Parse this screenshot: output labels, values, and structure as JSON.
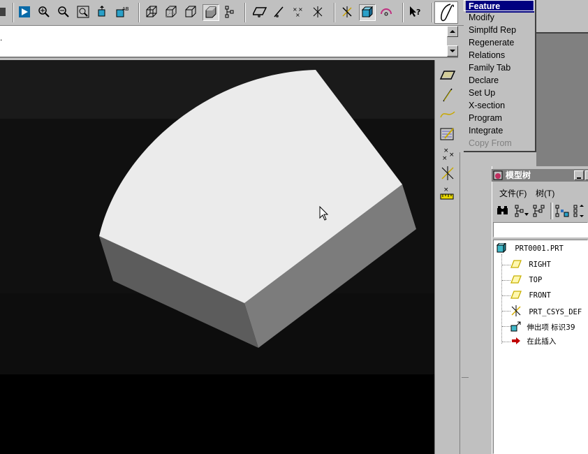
{
  "toolbar": {
    "buttons": [
      "regenerate-icon",
      "zoom-in-icon",
      "zoom-out-icon",
      "refit-icon",
      "orient-icon",
      "saved-views-icon",
      "wireframe-icon",
      "hidden-line-icon",
      "no-hidden-icon",
      "shading-icon",
      "model-tree-icon",
      "datum-planes-icon",
      "datum-axes-icon",
      "datum-points-icon",
      "coordinate-systems-icon",
      "spin-center-icon",
      "spin-box-icon",
      "spin-rotate-icon",
      "context-help-icon",
      "pro-engineer-logo"
    ]
  },
  "menu_manager": {
    "items": [
      {
        "label": "Feature",
        "selected": true,
        "disabled": false
      },
      {
        "label": "Modify",
        "selected": false,
        "disabled": false
      },
      {
        "label": "Simplfd Rep",
        "selected": false,
        "disabled": false
      },
      {
        "label": "Regenerate",
        "selected": false,
        "disabled": false
      },
      {
        "label": "Relations",
        "selected": false,
        "disabled": false
      },
      {
        "label": "Family Tab",
        "selected": false,
        "disabled": false
      },
      {
        "label": "Declare",
        "selected": false,
        "disabled": false
      },
      {
        "label": "Set Up",
        "selected": false,
        "disabled": false
      },
      {
        "label": "X-section",
        "selected": false,
        "disabled": false
      },
      {
        "label": "Program",
        "selected": false,
        "disabled": false
      },
      {
        "label": "Integrate",
        "selected": false,
        "disabled": false
      },
      {
        "label": "Copy From",
        "selected": false,
        "disabled": true
      }
    ]
  },
  "message_area": {
    "text": "."
  },
  "model_tree": {
    "title": "模型树",
    "menus": [
      "文件(F)",
      "树(T)"
    ],
    "nodes": [
      {
        "label": "PRT0001.PRT",
        "icon": "part-icon"
      },
      {
        "label": "RIGHT",
        "icon": "datum-plane-icon"
      },
      {
        "label": "TOP",
        "icon": "datum-plane-icon"
      },
      {
        "label": "FRONT",
        "icon": "datum-plane-icon"
      },
      {
        "label": "PRT_CSYS_DEF",
        "icon": "csys-icon"
      },
      {
        "label": "伸出项 标识39",
        "icon": "protrusion-icon"
      },
      {
        "label": "在此插入",
        "icon": "insert-here-icon"
      }
    ]
  },
  "colors": {
    "title_bar": "#000080",
    "datum_yellow": "#e8d800",
    "part_face_top": "#ebebeb",
    "part_face_front": "#7c7c7c",
    "part_face_side": "#5a5a5a"
  }
}
